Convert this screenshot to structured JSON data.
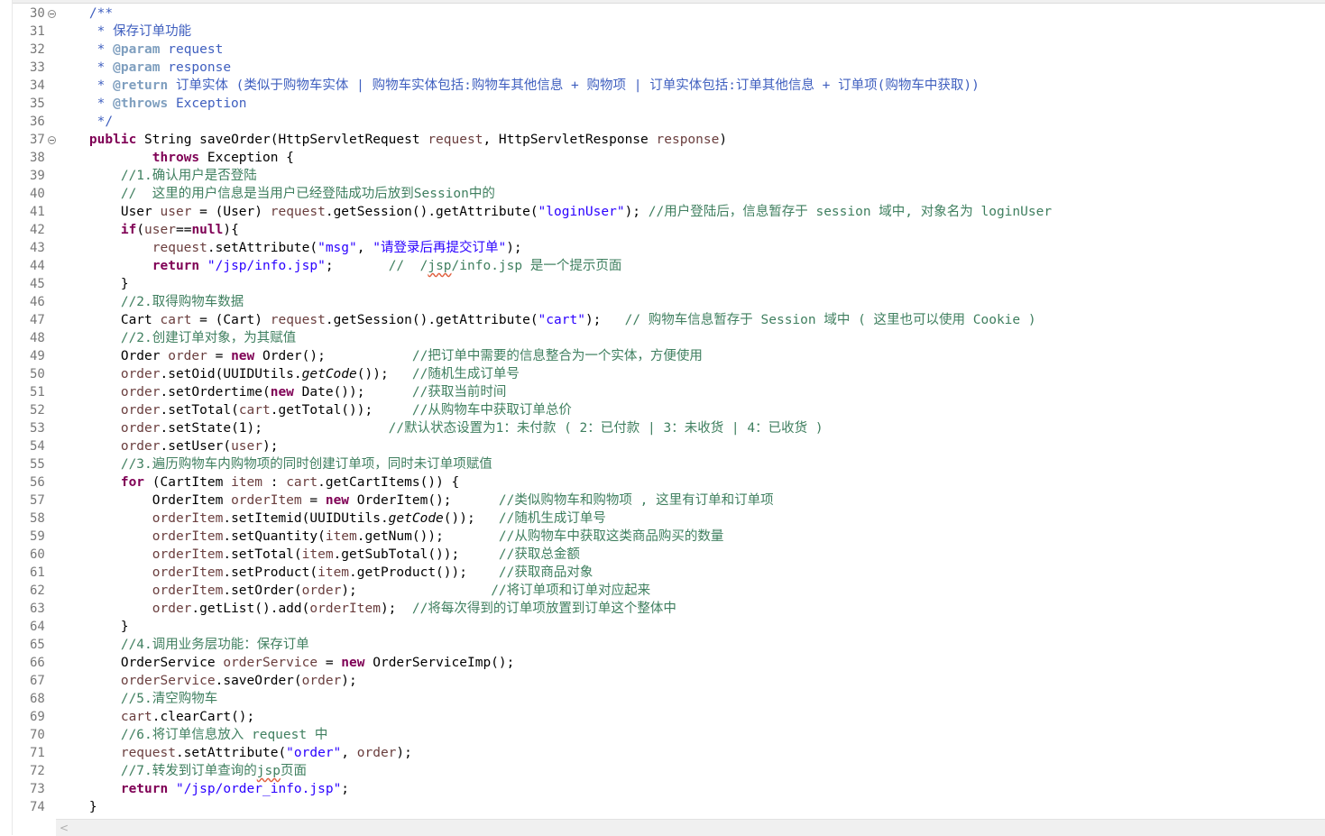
{
  "editor": {
    "line_numbers": [
      "30",
      "31",
      "32",
      "33",
      "34",
      "35",
      "36",
      "37",
      "38",
      "39",
      "40",
      "41",
      "42",
      "43",
      "44",
      "45",
      "46",
      "47",
      "48",
      "49",
      "50",
      "51",
      "52",
      "53",
      "54",
      "55",
      "56",
      "57",
      "58",
      "59",
      "60",
      "61",
      "62",
      "63",
      "64",
      "65",
      "66",
      "67",
      "68",
      "69",
      "70",
      "71",
      "72",
      "73",
      "74"
    ],
    "fold_markers_on": [
      "30",
      "37"
    ],
    "scroll_left_glyph": "<",
    "colors": {
      "keyword": "#7f0055",
      "string": "#2a00ff",
      "comment": "#3f7f5f",
      "javadoc": "#3f5fbf",
      "javadoc_tag": "#7f9fbf",
      "local_variable": "#6a3e3e",
      "field": "#0000c0"
    }
  },
  "code": {
    "l30": "    /**",
    "l31_a": "     * ",
    "l31_b": "保存订单功能",
    "l32_a": "     * ",
    "l32_tag": "@param",
    "l32_b": " request",
    "l33_a": "     * ",
    "l33_tag": "@param",
    "l33_b": " response",
    "l34_a": "     * ",
    "l34_tag": "@return",
    "l34_b": " 订单实体 (类似于购物车实体 | 购物车实体包括:购物车其他信息 + 购物项 | 订单实体包括:订单其他信息 + 订单项(购物车中获取))",
    "l35_a": "     * ",
    "l35_tag": "@throws",
    "l35_b": " Exception",
    "l36": "     */",
    "l37_kw": "public",
    "l37_a": " String saveOrder(HttpServletRequest ",
    "l37_v1": "request",
    "l37_b": ", HttpServletResponse ",
    "l37_v2": "response",
    "l37_c": ")",
    "l38_pre": "            ",
    "l38_kw": "throws",
    "l38_a": " Exception {",
    "l39": "        //1.确认用户是否登陆",
    "l40": "        //  这里的用户信息是当用户已经登陆成功后放到Session中的",
    "l41_a": "        User ",
    "l41_v1": "user",
    "l41_b": " = (User) ",
    "l41_v2": "request",
    "l41_c": ".getSession().getAttribute(",
    "l41_s": "\"loginUser\"",
    "l41_d": "); ",
    "l41_cm": "//用户登陆后，信息暂存于 session 域中, 对象名为 loginUser",
    "l42_pre": "        ",
    "l42_kw": "if",
    "l42_a": "(",
    "l42_v": "user",
    "l42_b": "==",
    "l42_kw2": "null",
    "l42_c": "){",
    "l43_pre": "            ",
    "l43_v": "request",
    "l43_a": ".setAttribute(",
    "l43_s1": "\"msg\"",
    "l43_b": ", ",
    "l43_s2": "\"请登录后再提交订单\"",
    "l43_c": ");",
    "l44_pre": "            ",
    "l44_kw": "return",
    "l44_a": " ",
    "l44_s": "\"/jsp/info.jsp\"",
    "l44_b": ";       ",
    "l44_cm1": "//  /",
    "l44_cm_u": "jsp",
    "l44_cm2": "/info.jsp 是一个提示页面",
    "l45": "        }",
    "l46": "        //2.取得购物车数据",
    "l47_a": "        Cart ",
    "l47_v1": "cart",
    "l47_b": " = (Cart) ",
    "l47_v2": "request",
    "l47_c": ".getSession().getAttribute(",
    "l47_s": "\"cart\"",
    "l47_d": ");   ",
    "l47_cm": "// 购物车信息暂存于 Session 域中 ( 这里也可以使用 Cookie )",
    "l48": "        //2.创建订单对象，为其赋值",
    "l49_a": "        Order ",
    "l49_v": "order",
    "l49_b": " = ",
    "l49_kw": "new",
    "l49_c": " Order();           ",
    "l49_cm": "//把订单中需要的信息整合为一个实体，方便使用",
    "l50_pre": "        ",
    "l50_v": "order",
    "l50_a": ".setOid(UUIDUtils.",
    "l50_i": "getCode",
    "l50_b": "());   ",
    "l50_cm": "//随机生成订单号",
    "l51_pre": "        ",
    "l51_v": "order",
    "l51_a": ".setOrdertime(",
    "l51_kw": "new",
    "l51_b": " Date());      ",
    "l51_cm": "//获取当前时间",
    "l52_pre": "        ",
    "l52_v1": "order",
    "l52_a": ".setTotal(",
    "l52_v2": "cart",
    "l52_b": ".getTotal());     ",
    "l52_cm": "//从购物车中获取订单总价",
    "l53_pre": "        ",
    "l53_v": "order",
    "l53_a": ".setState(1);                ",
    "l53_cm": "//默认状态设置为1：未付款 ( 2：已付款 | 3：未收货 | 4：已收货 )",
    "l54_pre": "        ",
    "l54_v1": "order",
    "l54_a": ".setUser(",
    "l54_v2": "user",
    "l54_b": ");",
    "l55": "        //3.遍历购物车内购物项的同时创建订单项，同时未订单项赋值",
    "l56_pre": "        ",
    "l56_kw": "for",
    "l56_a": " (CartItem ",
    "l56_v1": "item",
    "l56_b": " : ",
    "l56_v2": "cart",
    "l56_c": ".getCartItems()) {",
    "l57_a": "            OrderItem ",
    "l57_v": "orderItem",
    "l57_b": " = ",
    "l57_kw": "new",
    "l57_c": " OrderItem();      ",
    "l57_cm": "//类似购物车和购物项 , 这里有订单和订单项",
    "l58_pre": "            ",
    "l58_v": "orderItem",
    "l58_a": ".setItemid(UUIDUtils.",
    "l58_i": "getCode",
    "l58_b": "());   ",
    "l58_cm": "//随机生成订单号",
    "l59_pre": "            ",
    "l59_v1": "orderItem",
    "l59_a": ".setQuantity(",
    "l59_v2": "item",
    "l59_b": ".getNum());       ",
    "l59_cm": "//从购物车中获取这类商品购买的数量",
    "l60_pre": "            ",
    "l60_v1": "orderItem",
    "l60_a": ".setTotal(",
    "l60_v2": "item",
    "l60_b": ".getSubTotal());     ",
    "l60_cm": "//获取总金额",
    "l61_pre": "            ",
    "l61_v1": "orderItem",
    "l61_a": ".setProduct(",
    "l61_v2": "item",
    "l61_b": ".getProduct());    ",
    "l61_cm": "//获取商品对象",
    "l62_pre": "            ",
    "l62_v1": "orderItem",
    "l62_a": ".setOrder(",
    "l62_v2": "order",
    "l62_b": ");                 ",
    "l62_cm": "//将订单项和订单对应起来",
    "l63_pre": "            ",
    "l63_v1": "order",
    "l63_a": ".getList().add(",
    "l63_v2": "orderItem",
    "l63_b": ");  ",
    "l63_cm": "//将每次得到的订单项放置到订单这个整体中",
    "l64": "        }",
    "l65": "        //4.调用业务层功能：保存订单",
    "l66_a": "        OrderService ",
    "l66_v": "orderService",
    "l66_b": " = ",
    "l66_kw": "new",
    "l66_c": " OrderServiceImp();",
    "l67_pre": "        ",
    "l67_v1": "orderService",
    "l67_a": ".saveOrder(",
    "l67_v2": "order",
    "l67_b": ");",
    "l68": "        //5.清空购物车",
    "l69_pre": "        ",
    "l69_v": "cart",
    "l69_a": ".clearCart();",
    "l70": "        //6.将订单信息放入 request 中",
    "l71_pre": "        ",
    "l71_v1": "request",
    "l71_a": ".setAttribute(",
    "l71_s": "\"order\"",
    "l71_b": ", ",
    "l71_v2": "order",
    "l71_c": ");",
    "l72_a": "        //7.转发到订单查询的",
    "l72_u": "jsp",
    "l72_b": "页面",
    "l73_pre": "        ",
    "l73_kw": "return",
    "l73_a": " ",
    "l73_s": "\"/jsp/order_info.jsp\"",
    "l73_b": ";",
    "l74": "    }"
  }
}
